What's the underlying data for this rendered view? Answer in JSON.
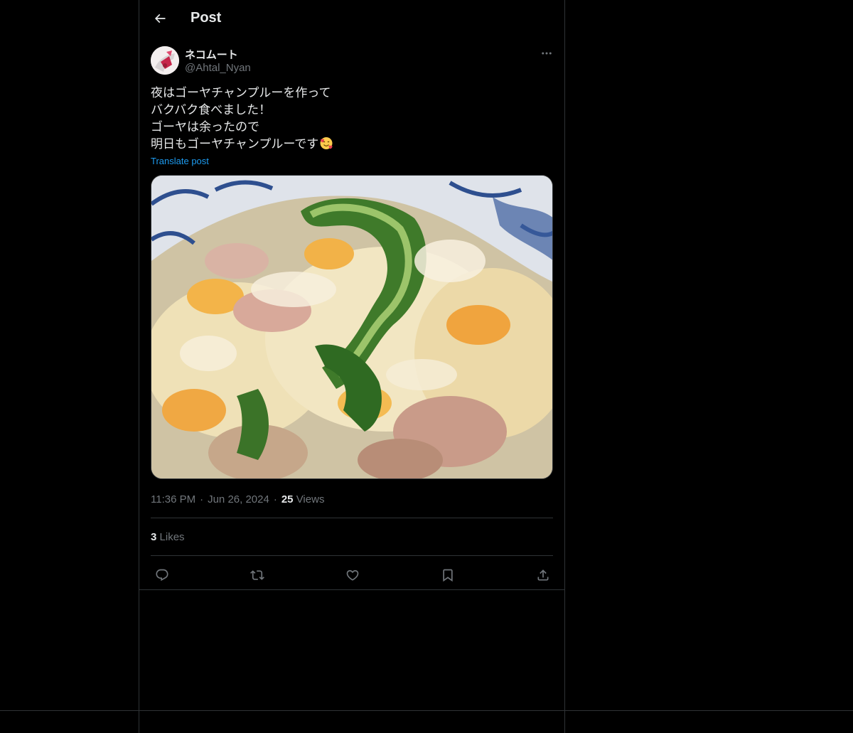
{
  "header": {
    "title": "Post",
    "back_icon": "arrow-left-icon"
  },
  "author": {
    "display_name": "ネコムート",
    "handle": "@Ahtal_Nyan",
    "avatar_icon": "avatar-image"
  },
  "post": {
    "lines": [
      "夜はゴーヤチャンプルーを作って",
      "バクバク食べました！",
      "ゴーヤは余ったので",
      "明日もゴーヤチャンプルーです"
    ],
    "trailing_emoji": "smiling-face-with-hearts-emoji",
    "translate_label": "Translate post",
    "media_description_icon": "goya-champuru-photo"
  },
  "meta": {
    "time": "11:36 PM",
    "separator": "·",
    "date": "Jun 26, 2024",
    "views_count": "25",
    "views_label": "Views"
  },
  "stats": {
    "likes_count": "3",
    "likes_label": "Likes"
  },
  "actions": {
    "reply_icon": "reply-icon",
    "repost_icon": "repost-icon",
    "like_icon": "heart-icon",
    "bookmark_icon": "bookmark-icon",
    "share_icon": "share-icon"
  },
  "colors": {
    "background": "#000000",
    "text_primary": "#e7e9ea",
    "text_secondary": "#71767b",
    "link": "#1d9bf0",
    "border": "#2f3336"
  }
}
